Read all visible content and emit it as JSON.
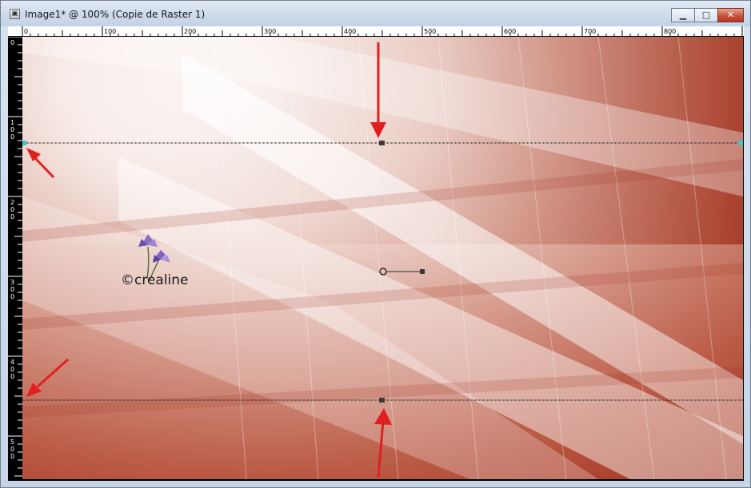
{
  "window": {
    "title": "Image1* @ 100% (Copie de Raster 1)",
    "app_icon": "paint-shop-pro-document-icon",
    "buttons": {
      "minimize": "minimize-icon",
      "maximize": "maximize-icon",
      "close": "close-icon"
    }
  },
  "ruler_top": {
    "labels": [
      "0",
      "100",
      "200",
      "300",
      "400",
      "500",
      "600",
      "700",
      "800"
    ]
  },
  "ruler_left": {
    "labels": [
      [
        "0"
      ],
      [
        "1",
        "0",
        "0"
      ],
      [
        "2",
        "0",
        "0"
      ],
      [
        "3",
        "0",
        "0"
      ],
      [
        "4",
        "0",
        "0"
      ],
      [
        "5",
        "0",
        "0"
      ]
    ]
  },
  "watermark": {
    "text": "©crealine",
    "icon": "iris-flower-icon"
  },
  "colors": {
    "image_dark": "#a33420",
    "image_light": "#ffffff",
    "guide_line": "#2a2a2a",
    "guide_handle": "#3fc7c7",
    "annotation_arrow": "#e02020"
  }
}
